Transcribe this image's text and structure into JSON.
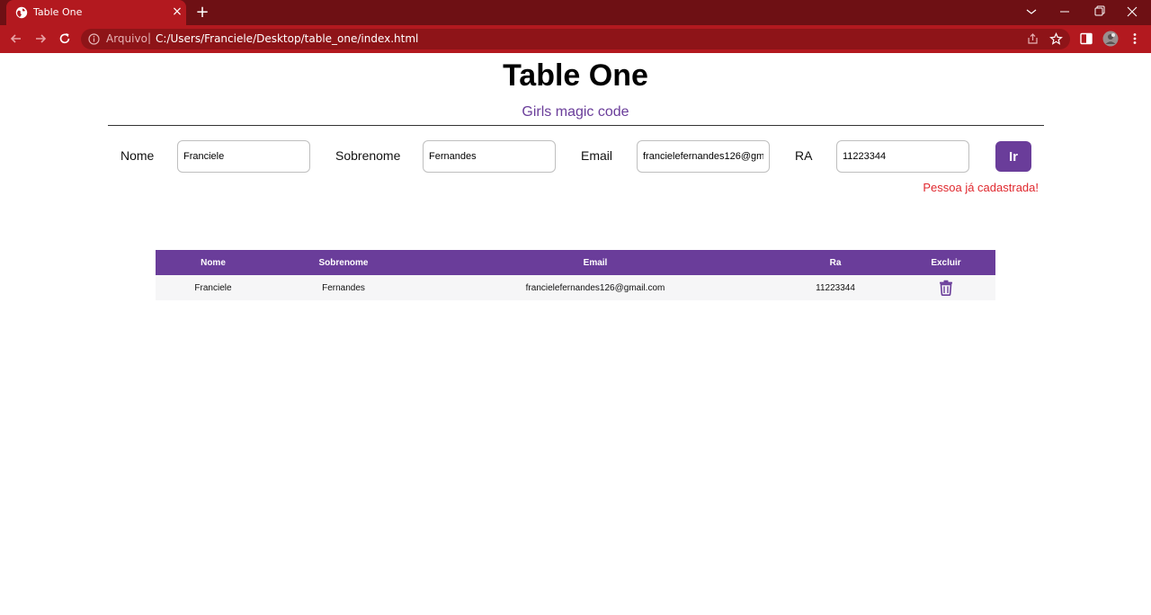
{
  "browser": {
    "tab_title": "Table One",
    "close_glyph": "×",
    "newtab_glyph": "+",
    "scheme_label": "Arquivo",
    "separator": "|",
    "url": "C:/Users/Franciele/Desktop/table_one/index.html"
  },
  "page": {
    "title": "Table One",
    "subtitle": "Girls magic code"
  },
  "form": {
    "nome_label": "Nome",
    "nome_value": "Franciele",
    "sobrenome_label": "Sobrenome",
    "sobrenome_value": "Fernandes",
    "email_label": "Email",
    "email_value": "francielefernandes126@gmail.com",
    "ra_label": "RA",
    "ra_value": "11223344",
    "submit_label": "Ir",
    "error_message": "Pessoa já cadastrada!"
  },
  "table": {
    "headers": [
      "Nome",
      "Sobrenome",
      "Email",
      "Ra",
      "Excluir"
    ],
    "rows": [
      [
        "Franciele",
        "Fernandes",
        "francielefernandes126@gmail.com",
        "11223344"
      ]
    ]
  },
  "colors": {
    "chrome_dark": "#6e1014",
    "chrome_accent": "#b3191f",
    "brand_purple": "#6a3d9a",
    "error_red": "#e0282e"
  },
  "icons": {
    "tab_favicon": "globe-icon",
    "back": "back-arrow-icon",
    "forward": "forward-arrow-icon",
    "reload": "reload-icon",
    "info": "info-icon",
    "share": "share-icon",
    "bookmark": "star-icon",
    "side_panel": "side-panel-icon",
    "profile": "avatar",
    "menu": "kebab-menu-icon",
    "delete": "trash-icon"
  }
}
